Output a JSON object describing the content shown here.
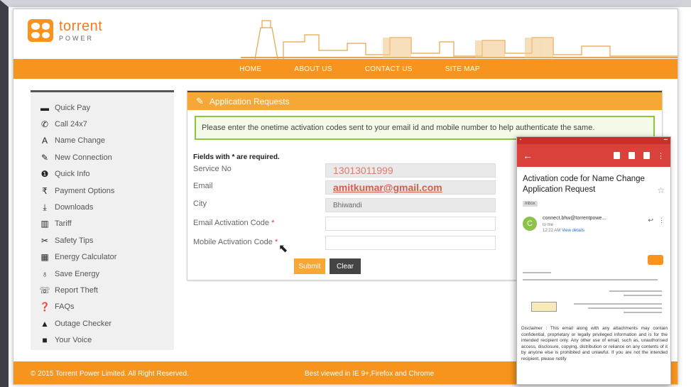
{
  "brand": {
    "name": "torrent",
    "sub": "POWER"
  },
  "nav": [
    "HOME",
    "ABOUT US",
    "CONTACT US",
    "SITE MAP"
  ],
  "sidebar": [
    {
      "icon": "credit-card-icon",
      "glyph": "▬",
      "label": "Quick Pay"
    },
    {
      "icon": "phone-icon",
      "glyph": "✆",
      "label": "Call 24x7"
    },
    {
      "icon": "font-icon",
      "glyph": "A",
      "label": "Name Change"
    },
    {
      "icon": "pencil-icon",
      "glyph": "✎",
      "label": "New Connection"
    },
    {
      "icon": "info-icon",
      "glyph": "❶",
      "label": "Quick Info"
    },
    {
      "icon": "rupee-icon",
      "glyph": "₹",
      "label": "Payment Options"
    },
    {
      "icon": "download-icon",
      "glyph": "⤓",
      "label": "Downloads"
    },
    {
      "icon": "book-icon",
      "glyph": "▥",
      "label": "Tariff"
    },
    {
      "icon": "wrench-icon",
      "glyph": "✂",
      "label": "Safety Tips"
    },
    {
      "icon": "calculator-icon",
      "glyph": "▦",
      "label": "Energy Calculator"
    },
    {
      "icon": "bulb-icon",
      "glyph": "♁",
      "label": "Save Energy"
    },
    {
      "icon": "report-icon",
      "glyph": "☏",
      "label": "Report Theft"
    },
    {
      "icon": "question-icon",
      "glyph": "❓",
      "label": "FAQs"
    },
    {
      "icon": "warning-icon",
      "glyph": "▲",
      "label": "Outage Checker"
    },
    {
      "icon": "comment-icon",
      "glyph": "■",
      "label": "Your Voice"
    }
  ],
  "panel": {
    "title": "Application Requests",
    "notice": "Please enter the onetime activation codes sent to your email id and mobile number to help authenticate the same.",
    "required_note": "Fields with * are required.",
    "fields": {
      "service_no_label": "Service No",
      "service_no_value": "13013011999",
      "email_label": "Email",
      "email_value": "amitkumar@gmail.com",
      "city_label": "City",
      "city_value": "Bhiwandi",
      "email_code_label": "Email Activation Code",
      "mobile_code_label": "Mobile Activation Code"
    },
    "submit_label": "Submit",
    "clear_label": "Clear"
  },
  "footer": {
    "copyright": "© 2015 Torrent Power Limited. All Right Reserved.",
    "best_viewed": "Best viewed in IE 9+,Firefox and Chrome"
  },
  "phone": {
    "subject": "Activation code for Name Change Application Request",
    "inbox_tag": "Inbox",
    "avatar_letter": "C",
    "sender": "connect.bhw@torrentpowe...",
    "to": "to me",
    "time": "12:22 AM",
    "view_details": "View details",
    "disclaimer": "Disclaimer : This email along with any attachments may contain confidential, proprietary or legally privileged information and is for the intended recipient only. Any other use of email, such as, unauthorised access, disclosure, copying, distribution or reliance on any contents of it by anyone else is prohibited and unlawful. If you are not the intended recipient, please notify"
  },
  "colors": {
    "accent": "#f7941d",
    "panel_head": "#f7a735",
    "notice_border": "#8cc63e",
    "gmail_red": "#d9413a"
  }
}
